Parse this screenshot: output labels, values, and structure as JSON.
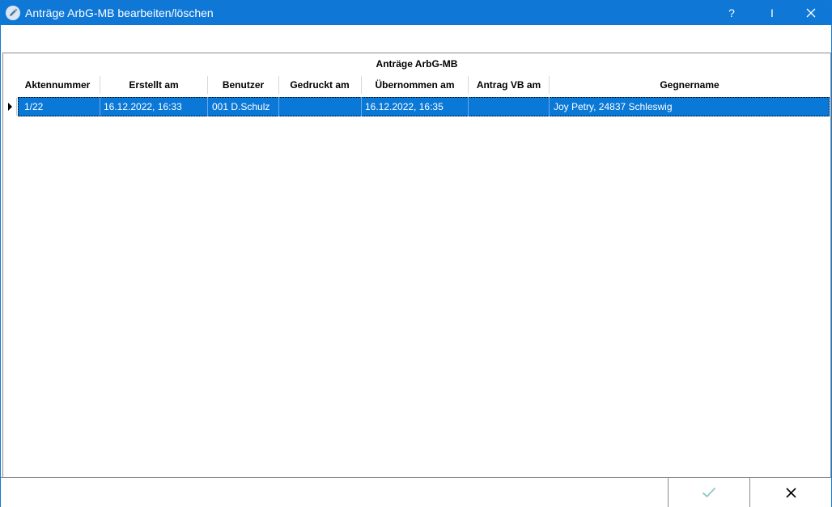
{
  "window": {
    "title": "Anträge ArbG-MB bearbeiten/löschen",
    "help_label": "?",
    "max_label": "I",
    "close_label": "✕",
    "accent_color": "#0f78d7"
  },
  "grid": {
    "title": "Anträge ArbG-MB",
    "columns": [
      "Aktennummer",
      "Erstellt am",
      "Benutzer",
      "Gedruckt am",
      "Übernommen am",
      "Antrag VB am",
      "Gegnername"
    ],
    "rows": [
      {
        "aktennummer": "1/22",
        "erstellt_am": "16.12.2022, 16:33",
        "benutzer": "001 D.Schulz",
        "gedruckt_am": "",
        "uebernommen_am": "16.12.2022, 16:35",
        "antrag_vb_am": "",
        "gegnername": "Joy Petry, 24837 Schleswig",
        "selected": true
      }
    ],
    "selection_color": "#0a78d7"
  },
  "footer": {
    "ok_icon": "check-icon",
    "cancel_icon": "close-icon"
  }
}
